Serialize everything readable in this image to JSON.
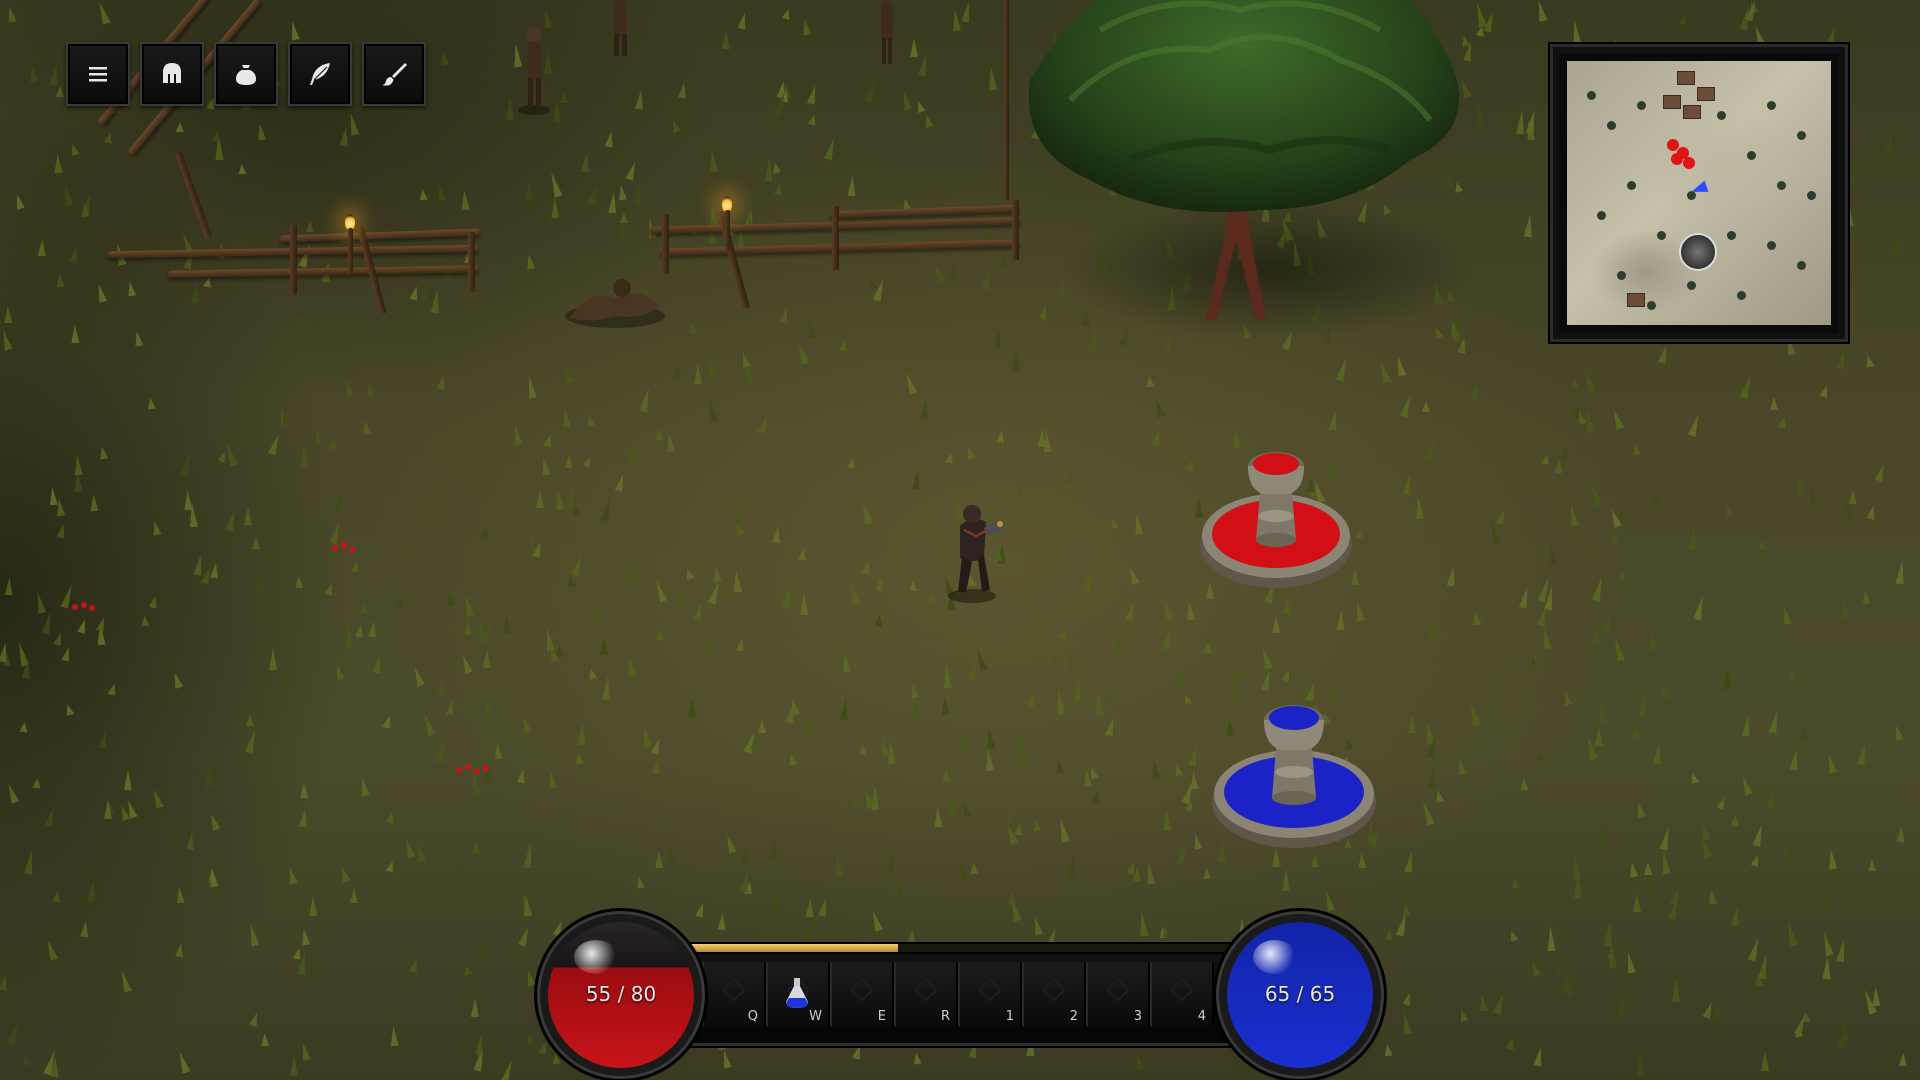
{
  "hud": {
    "menu_buttons": [
      {
        "name": "menu",
        "icon": "hamburger-menu-icon"
      },
      {
        "name": "character",
        "icon": "helmet-icon"
      },
      {
        "name": "inventory",
        "icon": "pouch-icon"
      },
      {
        "name": "skills",
        "icon": "feather-icon"
      },
      {
        "name": "quests",
        "icon": "brush-icon"
      }
    ],
    "health": {
      "label": "55 / 80",
      "current": 55,
      "max": 80,
      "color": "#c8141a"
    },
    "mana": {
      "label": "65 / 65",
      "current": 65,
      "max": 65,
      "color": "#1a2fd0"
    },
    "experience": {
      "fraction": 0.39,
      "color": "#d9ad4a"
    },
    "hotbar": [
      {
        "key": "Q",
        "item": ""
      },
      {
        "key": "W",
        "item": "blue-potion-icon"
      },
      {
        "key": "E",
        "item": ""
      },
      {
        "key": "R",
        "item": ""
      },
      {
        "key": "1",
        "item": ""
      },
      {
        "key": "2",
        "item": ""
      },
      {
        "key": "3",
        "item": ""
      },
      {
        "key": "4",
        "item": ""
      }
    ]
  },
  "world": {
    "fountains": [
      {
        "name": "health-fountain",
        "color": "#d10f14"
      },
      {
        "name": "mana-fountain",
        "color": "#1b22c6"
      }
    ]
  }
}
